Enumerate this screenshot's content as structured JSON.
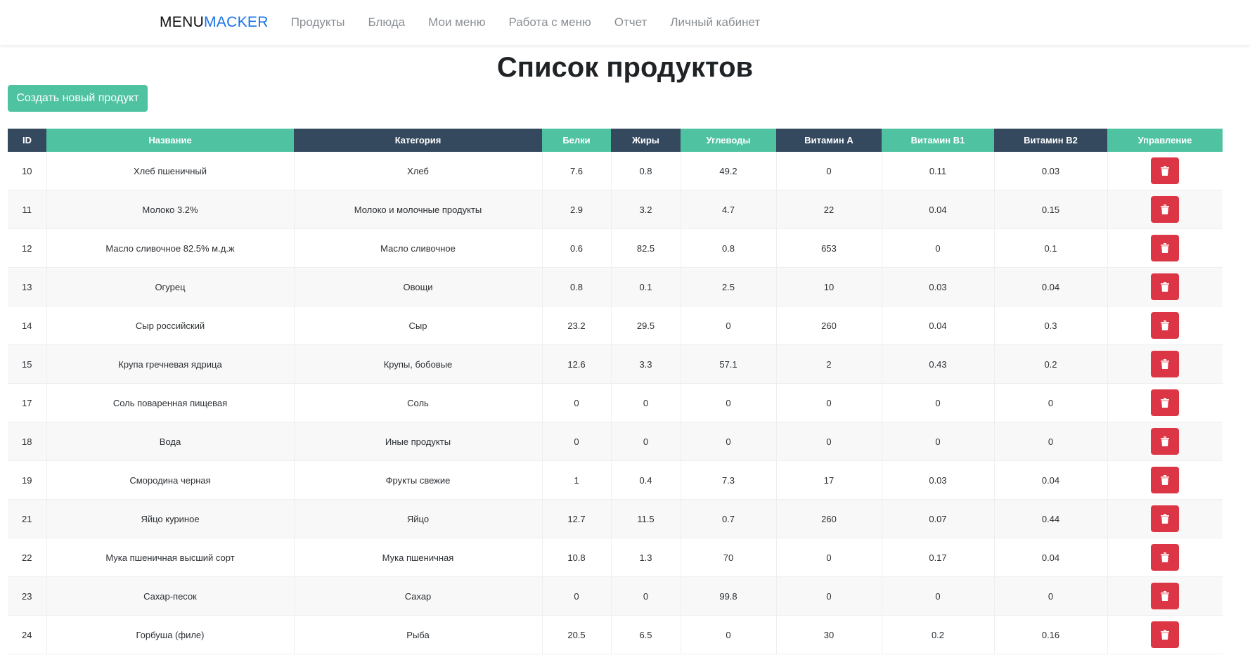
{
  "navbar": {
    "brand_part1": "MENU",
    "brand_part2": "MACKER",
    "links": [
      "Продукты",
      "Блюда",
      "Мои меню",
      "Работа с меню",
      "Отчет",
      "Личный кабинет"
    ]
  },
  "page": {
    "title": "Список продуктов",
    "create_button": "Создать новый продукт"
  },
  "colors": {
    "header_dark": "#34495e",
    "header_green": "#4fc3a1",
    "delete_red": "#dc3545",
    "brand_blue": "#1a73e8"
  },
  "table": {
    "columns": [
      "ID",
      "Название",
      "Категория",
      "Белки",
      "Жиры",
      "Углеводы",
      "Витамин A",
      "Витамин B1",
      "Витамин B2",
      "Управление"
    ],
    "delete_icon": "trash-icon",
    "rows": [
      [
        "10",
        "Хлеб пшеничный",
        "Хлеб",
        "7.6",
        "0.8",
        "49.2",
        "0",
        "0.11",
        "0.03"
      ],
      [
        "11",
        "Молоко 3.2%",
        "Молоко и молочные продукты",
        "2.9",
        "3.2",
        "4.7",
        "22",
        "0.04",
        "0.15"
      ],
      [
        "12",
        "Масло сливочное 82.5% м.д.ж",
        "Масло сливочное",
        "0.6",
        "82.5",
        "0.8",
        "653",
        "0",
        "0.1"
      ],
      [
        "13",
        "Огурец",
        "Овощи",
        "0.8",
        "0.1",
        "2.5",
        "10",
        "0.03",
        "0.04"
      ],
      [
        "14",
        "Сыр российский",
        "Сыр",
        "23.2",
        "29.5",
        "0",
        "260",
        "0.04",
        "0.3"
      ],
      [
        "15",
        "Крупа гречневая ядрица",
        "Крупы, бобовые",
        "12.6",
        "3.3",
        "57.1",
        "2",
        "0.43",
        "0.2"
      ],
      [
        "17",
        "Соль поваренная пищевая",
        "Соль",
        "0",
        "0",
        "0",
        "0",
        "0",
        "0"
      ],
      [
        "18",
        "Вода",
        "Иные продукты",
        "0",
        "0",
        "0",
        "0",
        "0",
        "0"
      ],
      [
        "19",
        "Смородина черная",
        "Фрукты свежие",
        "1",
        "0.4",
        "7.3",
        "17",
        "0.03",
        "0.04"
      ],
      [
        "21",
        "Яйцо куриное",
        "Яйцо",
        "12.7",
        "11.5",
        "0.7",
        "260",
        "0.07",
        "0.44"
      ],
      [
        "22",
        "Мука пшеничная высший сорт",
        "Мука пшеничная",
        "10.8",
        "1.3",
        "70",
        "0",
        "0.17",
        "0.04"
      ],
      [
        "23",
        "Сахар-песок",
        "Сахар",
        "0",
        "0",
        "99.8",
        "0",
        "0",
        "0"
      ],
      [
        "24",
        "Горбуша (филе)",
        "Рыба",
        "20.5",
        "6.5",
        "0",
        "30",
        "0.2",
        "0.16"
      ]
    ]
  }
}
